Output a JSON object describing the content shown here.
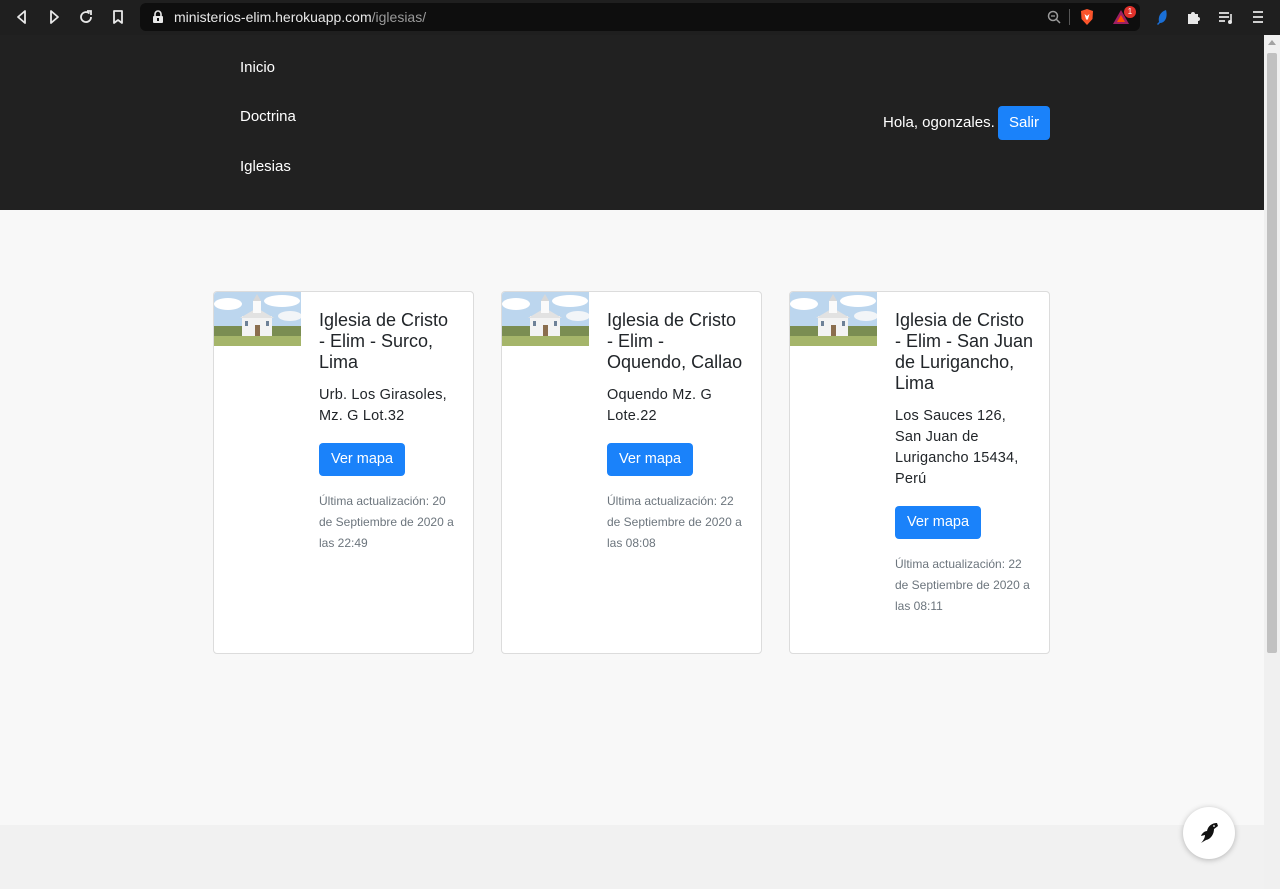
{
  "browser": {
    "url_host": "ministerios-elim.herokuapp.com",
    "url_path": "/iglesias/",
    "badge_count": "1",
    "icons": [
      "back-icon",
      "forward-icon",
      "reload-icon",
      "bookmark-icon",
      "lock-icon",
      "zoom-icon",
      "brave-shield-icon",
      "brave-rewards-icon",
      "extension-feather-icon",
      "puzzle-icon",
      "media-playlist-icon",
      "menu-icon"
    ]
  },
  "nav": {
    "items": [
      {
        "label": "Inicio"
      },
      {
        "label": "Doctrina"
      },
      {
        "label": "Iglesias"
      }
    ],
    "greeting": "Hola, ogonzales.",
    "logout_label": "Salir"
  },
  "churches": [
    {
      "name": "Iglesia de Cristo - Elim - Surco, Lima",
      "address": "Urb. Los Girasoles, Mz. G Lot.32",
      "map_label": "Ver mapa",
      "updated": "Última actualización: 20 de Septiembre de 2020 a las 22:49"
    },
    {
      "name": "Iglesia de Cristo - Elim - Oquendo, Callao",
      "address": "Oquendo Mz. G Lote.22",
      "map_label": "Ver mapa",
      "updated": "Última actualización: 22 de Septiembre de 2020 a las 08:08"
    },
    {
      "name": "Iglesia de Cristo - Elim - San Juan de Lurigancho, Lima",
      "address": "Los Sauces 126, San Juan de Lurigancho 15434, Perú",
      "map_label": "Ver mapa",
      "updated": "Última actualización: 22 de Septiembre de 2020 a las 08:11"
    }
  ],
  "colors": {
    "header_bg": "#212121",
    "primary": "#1a82fa",
    "page_bg": "#f8f8f8"
  }
}
